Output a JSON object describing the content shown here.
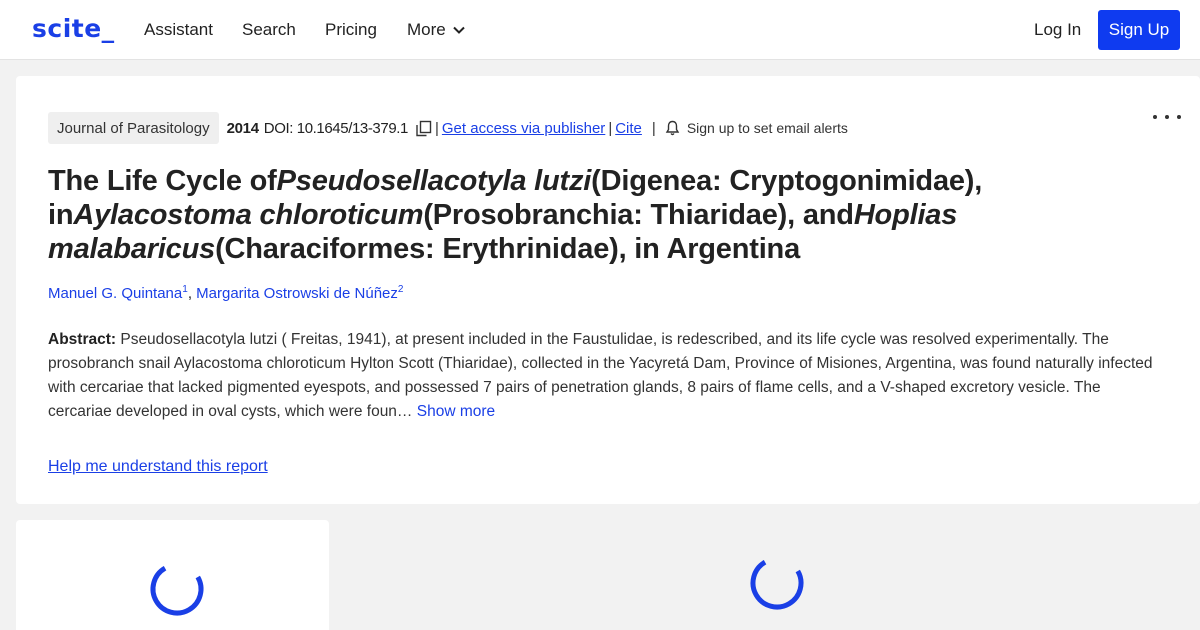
{
  "nav": {
    "logo": "scite_",
    "links": [
      "Assistant",
      "Search",
      "Pricing",
      "More"
    ],
    "login": "Log In",
    "signup": "Sign Up"
  },
  "article": {
    "journal": "Journal of Parasitology",
    "year": "2014",
    "doi": "DOI: 10.1645/13-379.1",
    "access_link": "Get access via publisher",
    "cite_link": "Cite",
    "alert_text": "Sign up to set email alerts",
    "title_parts": [
      "The Life Cycle of",
      "Pseudosellacotyla lutzi",
      "(Digenea: Cryptogonimidae), in",
      "Aylacostoma chloroticum",
      "(Prosobranchia: Thiaridae), and",
      "Hoplias malabaricus",
      "(Characiformes: Erythrinidae), in Argentina"
    ],
    "authors": [
      {
        "name": "Manuel G. Quintana",
        "sup": "1"
      },
      {
        "name": "Margarita Ostrowski de Núñez",
        "sup": "2"
      }
    ],
    "abstract_label": "Abstract:",
    "abstract_text": " Pseudosellacotyla lutzi ( Freitas, 1941), at present included in the Faustulidae, is redescribed, and its life cycle was resolved experimentally. The prosobranch snail Aylacostoma chloroticum Hylton Scott (Thiaridae), collected in the Yacyretá Dam, Province of Misiones, Argentina, was found naturally infected with cercariae that lacked pigmented eyespots, and possessed 7 pairs of penetration glands, 8 pairs of flame cells, and a V-shaped excretory vesicle. The cercariae developed in oval cysts, which were foun…",
    "show_more": " Show more",
    "help_link": "Help me understand this report"
  },
  "colors": {
    "brand": "#1a3fe6",
    "signup_bg": "#0f3bf0",
    "page_bg": "#f2f2f2"
  },
  "icons": [
    "chevron-down-icon",
    "copy-icon",
    "bell-icon",
    "more-options-icon",
    "loading-spinner-icon"
  ]
}
